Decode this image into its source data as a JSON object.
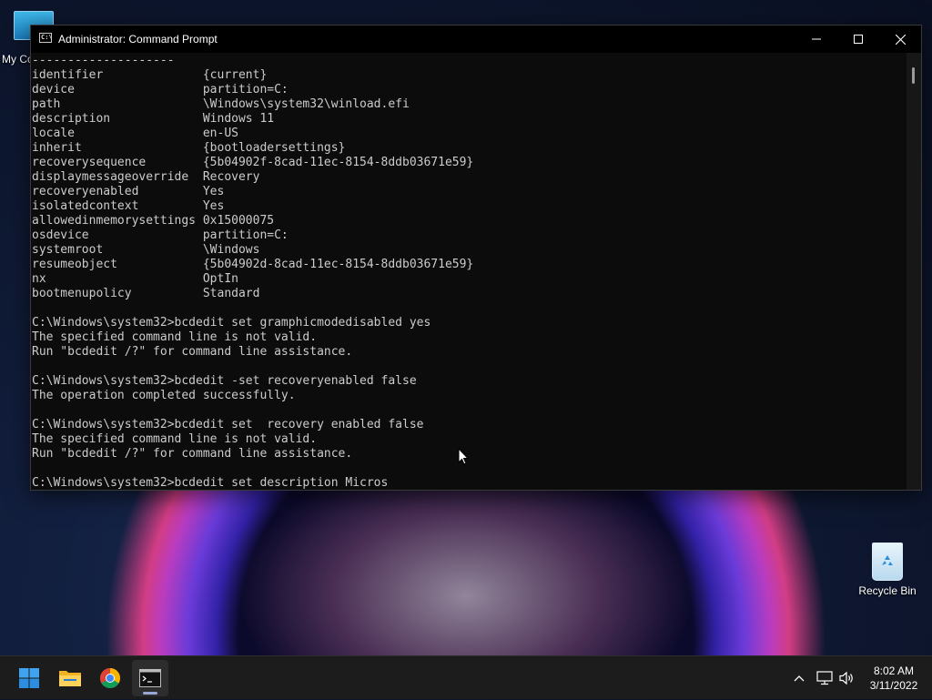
{
  "desktop": {
    "icons": [
      {
        "label": "My Co"
      },
      {
        "label": "Recycle Bin"
      }
    ]
  },
  "window": {
    "title": "Administrator: Command Prompt",
    "console_lines": [
      "--------------------",
      "identifier              {current}",
      "device                  partition=C:",
      "path                    \\Windows\\system32\\winload.efi",
      "description             Windows 11",
      "locale                  en-US",
      "inherit                 {bootloadersettings}",
      "recoverysequence        {5b04902f-8cad-11ec-8154-8ddb03671e59}",
      "displaymessageoverride  Recovery",
      "recoveryenabled         Yes",
      "isolatedcontext         Yes",
      "allowedinmemorysettings 0x15000075",
      "osdevice                partition=C:",
      "systemroot              \\Windows",
      "resumeobject            {5b04902d-8cad-11ec-8154-8ddb03671e59}",
      "nx                      OptIn",
      "bootmenupolicy          Standard",
      "",
      "C:\\Windows\\system32>bcdedit set gramphicmodedisabled yes",
      "The specified command line is not valid.",
      "Run \"bcdedit /?\" for command line assistance.",
      "",
      "C:\\Windows\\system32>bcdedit -set recoveryenabled false",
      "The operation completed successfully.",
      "",
      "C:\\Windows\\system32>bcdedit set  recovery enabled false",
      "The specified command line is not valid.",
      "Run \"bcdedit /?\" for command line assistance.",
      "",
      "C:\\Windows\\system32>bcdedit set description Micros"
    ]
  },
  "taskbar": {
    "apps": [
      {
        "name": "start-icon"
      },
      {
        "name": "file-explorer-icon"
      },
      {
        "name": "chrome-icon"
      },
      {
        "name": "command-prompt-icon"
      }
    ],
    "tray": {
      "time": "8:02 AM",
      "date": "3/11/2022"
    }
  },
  "colors": {
    "console_text": "#cccccc",
    "console_bg": "#0c0c0c",
    "taskbar_bg": "#1c1c1c"
  }
}
